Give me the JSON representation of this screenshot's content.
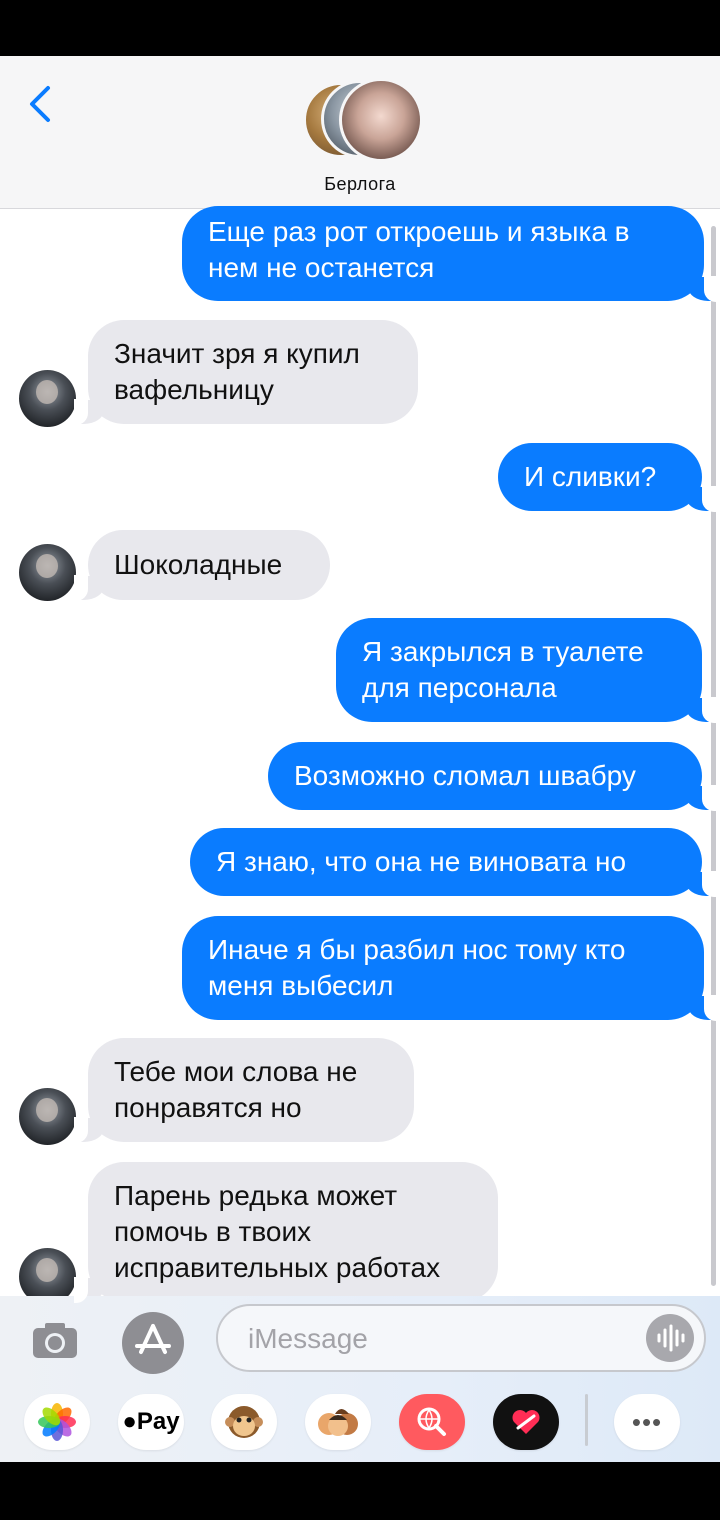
{
  "header": {
    "back_label": "‹",
    "group_name": "Берлога"
  },
  "messages": [
    {
      "dir": "out",
      "lines": [
        "Еще раз рот откроешь и языка в",
        "нем не останется"
      ]
    },
    {
      "dir": "in",
      "lines": [
        "Значит зря я купил",
        "вафельницу"
      ]
    },
    {
      "dir": "out",
      "lines": [
        "И сливки?"
      ]
    },
    {
      "dir": "in",
      "lines": [
        "Шоколадные"
      ]
    },
    {
      "dir": "out",
      "lines": [
        "Я закрылся в туалете",
        "для персонала"
      ]
    },
    {
      "dir": "out",
      "lines": [
        "Возможно сломал швабру"
      ]
    },
    {
      "dir": "out",
      "lines": [
        "Я знаю, что она не виновата но"
      ]
    },
    {
      "dir": "out",
      "lines": [
        "Иначе я бы разбил нос тому кто",
        "меня выбесил"
      ]
    },
    {
      "dir": "in",
      "lines": [
        "Тебе мои слова не",
        "понравятся но"
      ]
    },
    {
      "dir": "in",
      "lines": [
        "Парень редька может",
        "помочь в твоих",
        "исправительных работах"
      ]
    }
  ],
  "input": {
    "placeholder": "iMessage"
  },
  "app_drawer": {
    "apple_pay_label": "Pay",
    "more_label": "•••"
  },
  "colors": {
    "outgoing_bubble": "#0a7cff",
    "incoming_bubble": "#e8e8ed",
    "accent": "#0a7cff"
  },
  "icons": [
    "back-chevron-icon",
    "camera-icon",
    "app-store-icon",
    "voice-memo-icon",
    "photos-icon",
    "apple-pay-icon",
    "animoji-monkey-icon",
    "memoji-stickers-icon",
    "image-search-icon",
    "digital-touch-icon",
    "more-icon"
  ]
}
